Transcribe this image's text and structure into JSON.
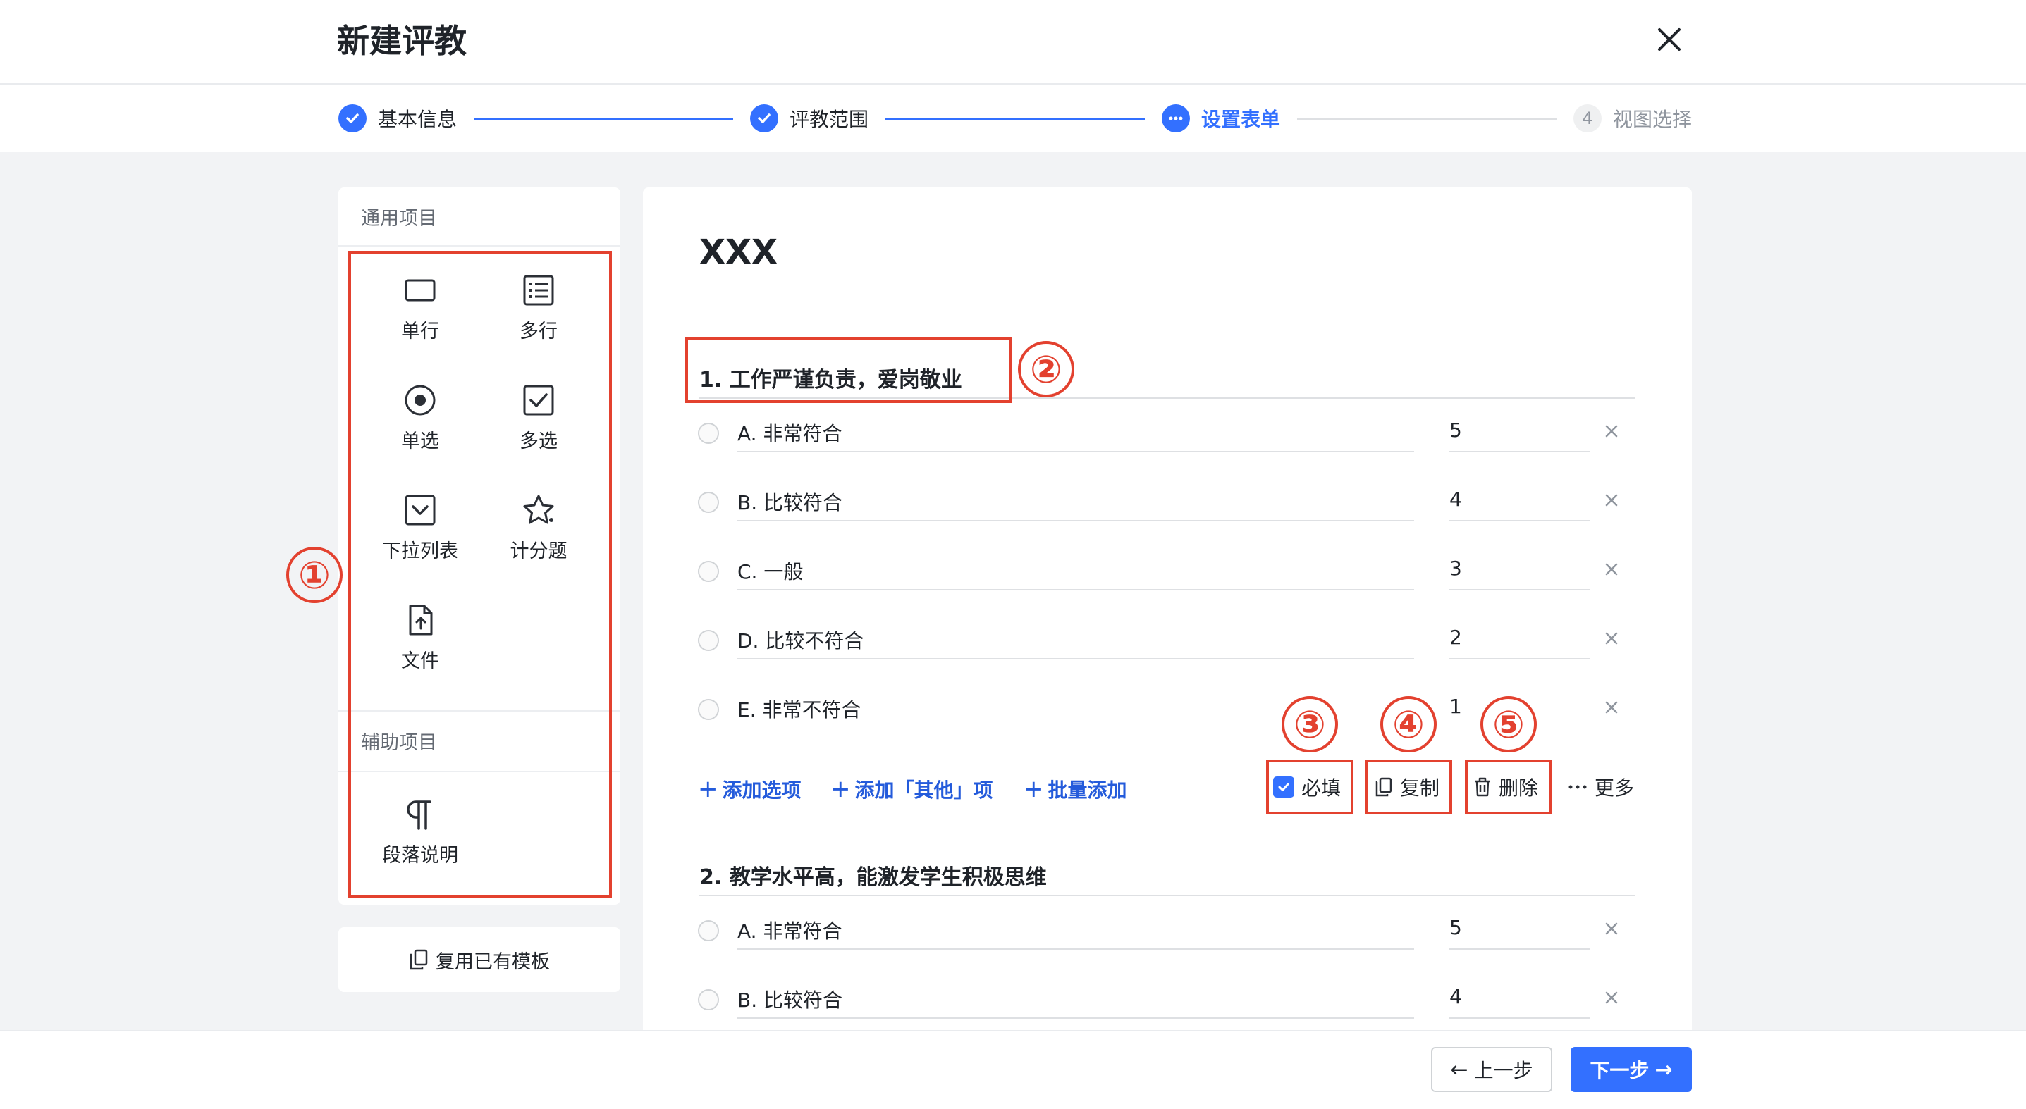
{
  "header": {
    "title": "新建评教",
    "close_icon": "close-icon"
  },
  "steps": [
    {
      "label": "基本信息",
      "state": "done"
    },
    {
      "label": "评教范围",
      "state": "done"
    },
    {
      "label": "设置表单",
      "state": "active"
    },
    {
      "label": "视图选择",
      "state": "todo",
      "number": "4"
    }
  ],
  "palette": {
    "common_title": "通用项目",
    "common_items": [
      {
        "label": "单行",
        "icon": "single-line-icon"
      },
      {
        "label": "多行",
        "icon": "multi-line-icon"
      },
      {
        "label": "单选",
        "icon": "radio-icon"
      },
      {
        "label": "多选",
        "icon": "checkbox-icon"
      },
      {
        "label": "下拉列表",
        "icon": "dropdown-icon"
      },
      {
        "label": "计分题",
        "icon": "star-icon"
      },
      {
        "label": "文件",
        "icon": "file-upload-icon"
      }
    ],
    "aux_title": "辅助项目",
    "aux_items": [
      {
        "label": "段落说明",
        "icon": "paragraph-icon"
      }
    ],
    "reuse_label": "复用已有模板"
  },
  "form": {
    "title": "XXX",
    "questions": [
      {
        "title": "1. 工作严谨负责，爱岗敬业",
        "options": [
          {
            "text": "A. 非常符合",
            "score": "5"
          },
          {
            "text": "B. 比较符合",
            "score": "4"
          },
          {
            "text": "C. 一般",
            "score": "3"
          },
          {
            "text": "D. 比较不符合",
            "score": "2"
          },
          {
            "text": "E. 非常不符合",
            "score": "1"
          }
        ]
      },
      {
        "title": "2. 教学水平高，能激发学生积极思维",
        "options": [
          {
            "text": "A. 非常符合",
            "score": "5"
          },
          {
            "text": "B. 比较符合",
            "score": "4"
          }
        ]
      }
    ],
    "actions": {
      "add_option": "添加选项",
      "add_other": "添加「其他」项",
      "batch_add": "批量添加",
      "required": "必填",
      "required_checked": true,
      "copy": "复制",
      "delete": "删除",
      "more": "更多"
    }
  },
  "annotations": [
    "①",
    "②",
    "③",
    "④",
    "⑤"
  ],
  "footer": {
    "prev": "上一步",
    "next": "下一步"
  },
  "colors": {
    "accent": "#3370ff",
    "annotation_red": "#e3412f",
    "link_blue": "#245bdb"
  }
}
